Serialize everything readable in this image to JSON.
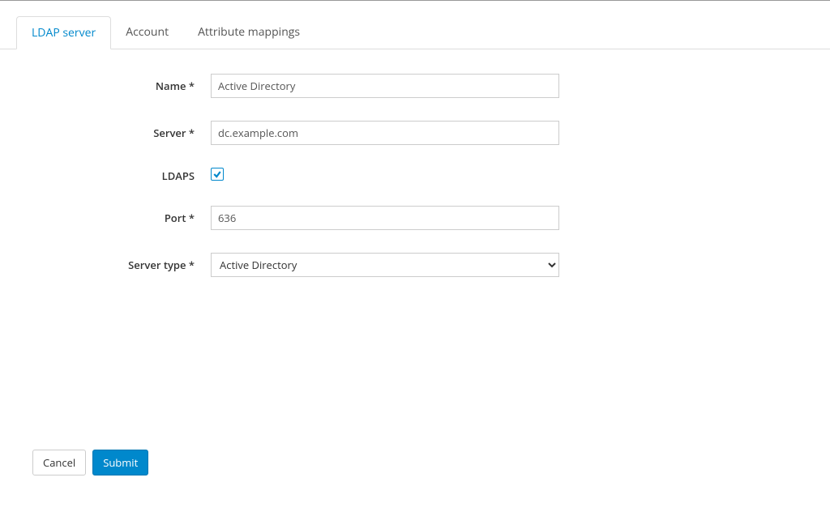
{
  "tabs": {
    "ldap_server": "LDAP server",
    "account": "Account",
    "attribute_mappings": "Attribute mappings"
  },
  "form": {
    "name": {
      "label": "Name *",
      "value": "Active Directory"
    },
    "server": {
      "label": "Server *",
      "value": "dc.example.com"
    },
    "ldaps": {
      "label": "LDAPS",
      "checked": true
    },
    "port": {
      "label": "Port *",
      "value": "636"
    },
    "server_type": {
      "label": "Server type *",
      "selected": "Active Directory"
    }
  },
  "buttons": {
    "cancel": "Cancel",
    "submit": "Submit"
  }
}
